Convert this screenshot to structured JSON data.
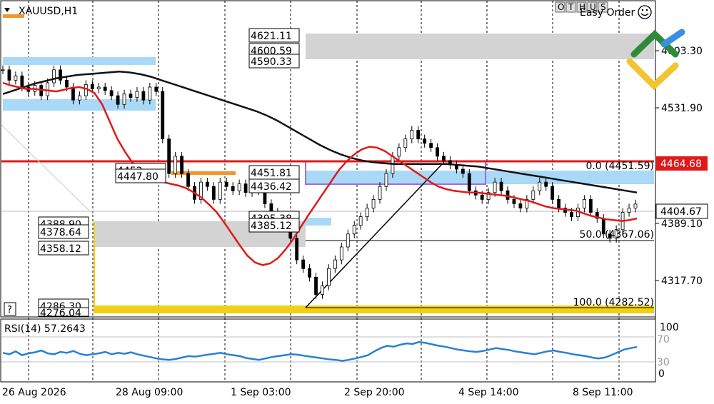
{
  "window": {
    "symbol_label": "XAUUSD,H1",
    "toolbar_letters": [
      "O",
      "T",
      "H",
      "U",
      "S"
    ],
    "easy_order_label": "Easy Order",
    "question_label": "?"
  },
  "colors": {
    "ma_fast": "#e01919",
    "ma_slow": "#111111",
    "zone_blue": "#a9d9f7",
    "zone_gray": "#d3d3d3",
    "zone_yellow": "#f2cf14",
    "resistance_red": "#e01919",
    "rsi_line": "#2a7fd6",
    "candle": "#000000",
    "logo_green": "#2e8b3c",
    "logo_blue": "#3a8fe0",
    "logo_yellow": "#f0c530"
  },
  "chart_data": [
    {
      "type": "line",
      "title": "XAUUSD,H1",
      "y_axis_labels": [
        "4603.30",
        "4531.90",
        "4389.10",
        "4317.70"
      ],
      "ylim": [
        4274,
        4640
      ],
      "x_axis_labels": [
        "26 Aug 2026",
        "28 Aug 09:00",
        "1 Sep 03:00",
        "2 Sep 20:00",
        "4 Sep 14:00",
        "8 Sep 11:00"
      ],
      "current_price": "4404.67",
      "resistance_price": "4464.68",
      "series": [
        {
          "role": "close",
          "values": [
            4560,
            4548,
            4553,
            4540,
            4535,
            4542,
            4530,
            4545,
            4560,
            4548,
            4540,
            4525,
            4530,
            4543,
            4538,
            4540,
            4536,
            4530,
            4520,
            4532,
            4528,
            4535,
            4525,
            4540,
            4535,
            4480,
            4440,
            4460,
            4440,
            4425,
            4410,
            4430,
            4425,
            4410,
            4430,
            4425,
            4420,
            4428,
            4418,
            4425,
            4420,
            4405,
            4395,
            4390,
            4380,
            4365,
            4340,
            4330,
            4320,
            4300,
            4310,
            4330,
            4340,
            4355,
            4370,
            4380,
            4390,
            4400,
            4410,
            4425,
            4440,
            4460,
            4470,
            4480,
            4490,
            4480,
            4475,
            4470,
            4460,
            4455,
            4450,
            4445,
            4440,
            4420,
            4415,
            4410,
            4418,
            4430,
            4420,
            4410,
            4405,
            4400,
            4410,
            4420,
            4430,
            4425,
            4410,
            4400,
            4395,
            4390,
            4400,
            4410,
            4395,
            4388,
            4370,
            4365,
            4375,
            4395,
            4400,
            4404.67
          ]
        },
        {
          "role": "ma_fast",
          "values": [
            4545,
            4542,
            4540,
            4538,
            4538,
            4537,
            4536,
            4535,
            4537,
            4539,
            4540,
            4538,
            4533,
            4520,
            4500,
            4480,
            4465,
            4452,
            4442,
            4436,
            4432,
            4430,
            4428,
            4426,
            4423,
            4418,
            4412,
            4404,
            4395,
            4383,
            4370,
            4357,
            4345,
            4337,
            4334,
            4336,
            4342,
            4352,
            4364,
            4378,
            4392,
            4405,
            4418,
            4431,
            4444,
            4454,
            4462,
            4468,
            4471,
            4470,
            4466,
            4460,
            4454,
            4448,
            4442,
            4436,
            4430,
            4425,
            4422,
            4420,
            4419,
            4418,
            4418,
            4417,
            4416,
            4415,
            4414,
            4412,
            4410,
            4408,
            4405,
            4402,
            4400,
            4399,
            4398,
            4397,
            4394,
            4391,
            4389,
            4387,
            4386,
            4385,
            4386,
            4388
          ]
        },
        {
          "role": "ma_slow",
          "values": [
            4532,
            4536,
            4540,
            4544,
            4547,
            4550,
            4552,
            4554,
            4555,
            4556,
            4557,
            4558,
            4557,
            4555,
            4552,
            4548,
            4544,
            4540,
            4536,
            4532,
            4528,
            4524,
            4520,
            4516,
            4512,
            4507,
            4501,
            4494,
            4487,
            4480,
            4473,
            4467,
            4462,
            4458,
            4455,
            4453,
            4452,
            4451,
            4451,
            4451,
            4451,
            4451,
            4451,
            4450,
            4449,
            4448,
            4446,
            4444,
            4442,
            4440,
            4438,
            4436,
            4434,
            4432,
            4430,
            4428,
            4426,
            4424,
            4422,
            4420,
            4418
          ]
        }
      ],
      "price_labels": [
        "4621.11",
        "4600.59",
        "4590.33",
        "4452.",
        "4447.80",
        "4451.81",
        "4436.42",
        "4395.38",
        "4385.12",
        "4388.90",
        "4378.64",
        "4358.12",
        "4286.30",
        "4276.04"
      ],
      "fib_labels": [
        "0.0 (4451.59)",
        "50.0 (4367.06)",
        "100.0 (4282.52)"
      ]
    },
    {
      "type": "line",
      "title": "RSI(14) 57.2643",
      "y_axis_labels": [
        "100",
        "70",
        "30",
        "0"
      ],
      "ylim": [
        0,
        100
      ],
      "levels": [
        70,
        30
      ],
      "series": [
        {
          "role": "rsi",
          "values": [
            45,
            42,
            48,
            40,
            44,
            46,
            50,
            44,
            42,
            47,
            45,
            49,
            43,
            40,
            42,
            44,
            47,
            42,
            45,
            43,
            46,
            42,
            39,
            36,
            33,
            31,
            30,
            32,
            35,
            38,
            37,
            39,
            41,
            43,
            45,
            42,
            40,
            38,
            34,
            32,
            30,
            33,
            36,
            38,
            40,
            42,
            41,
            39,
            37,
            35,
            33,
            31,
            30,
            28,
            30,
            33,
            36,
            40,
            48,
            55,
            60,
            58,
            62,
            65,
            64,
            68,
            66,
            63,
            60,
            58,
            55,
            52,
            50,
            48,
            47,
            49,
            52,
            55,
            53,
            51,
            48,
            46,
            44,
            42,
            45,
            48,
            50,
            47,
            45,
            42,
            40,
            38,
            35,
            33,
            35,
            40,
            46,
            52,
            55,
            57.26
          ]
        }
      ]
    }
  ]
}
